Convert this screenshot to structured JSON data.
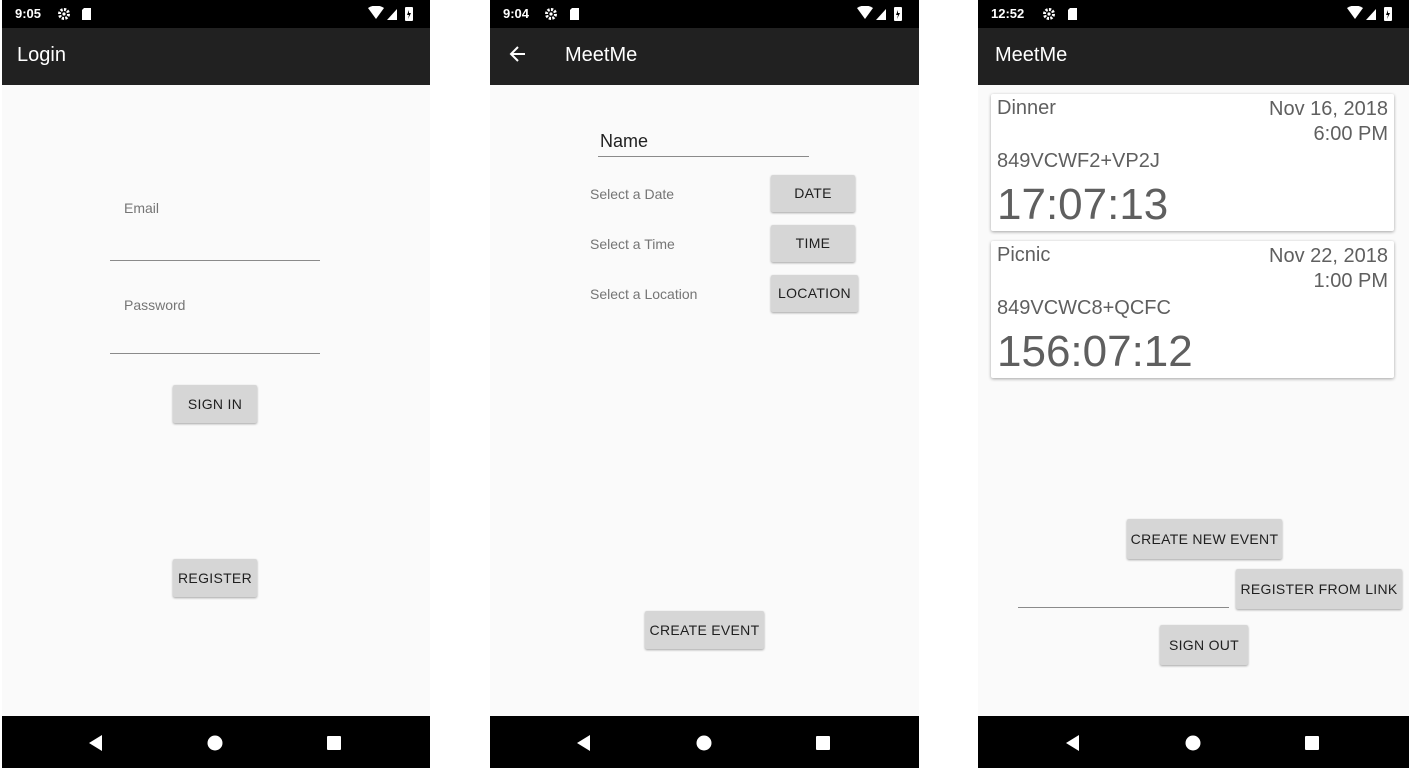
{
  "screens": [
    {
      "status_time": "9:05",
      "app_title": "Login",
      "email_hint": "Email",
      "password_hint": "Password",
      "sign_in_label": "SIGN IN",
      "register_label": "REGISTER"
    },
    {
      "status_time": "9:04",
      "app_title": "MeetMe",
      "name_value": "Name",
      "date_prompt": "Select a Date",
      "date_button": "DATE",
      "time_prompt": "Select a Time",
      "time_button": "TIME",
      "location_prompt": "Select a Location",
      "location_button": "LOCATION",
      "create_event_label": "CREATE EVENT"
    },
    {
      "status_time": "12:52",
      "app_title": "MeetMe",
      "events": [
        {
          "name": "Dinner",
          "date": "Nov 16, 2018",
          "time": "6:00 PM",
          "code": "849VCWF2+VP2J",
          "countdown": "17:07:13"
        },
        {
          "name": "Picnic",
          "date": "Nov 22, 2018",
          "time": "1:00 PM",
          "code": "849VCWC8+QCFC",
          "countdown": "156:07:12"
        }
      ],
      "create_new_event_label": "CREATE NEW EVENT",
      "register_from_link_label": "REGISTER FROM LINK",
      "sign_out_label": "SIGN OUT"
    }
  ],
  "icons": {
    "status": [
      "settings-icon",
      "sd-card-icon",
      "wifi-icon",
      "signal-icon",
      "battery-icon"
    ],
    "nav": [
      "back-nav-icon",
      "home-nav-icon",
      "recents-nav-icon"
    ],
    "appbar": [
      "back-arrow-icon"
    ]
  },
  "colors": {
    "appbar": "#212121",
    "status_bar": "#000000",
    "background": "#fafafa",
    "button": "#d6d6d6"
  }
}
